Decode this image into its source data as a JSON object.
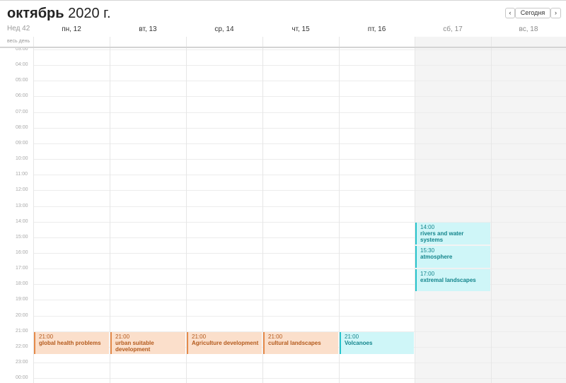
{
  "title": {
    "month": "октябрь",
    "year_suffix": "2020 г."
  },
  "nav": {
    "prev": "‹",
    "today": "Сегодня",
    "next": "›"
  },
  "week_label": "Нед 42",
  "all_day_label": "весь день",
  "days": [
    {
      "label": "пн, 12",
      "weekend": false
    },
    {
      "label": "вт, 13",
      "weekend": false
    },
    {
      "label": "ср, 14",
      "weekend": false
    },
    {
      "label": "чт, 15",
      "weekend": false
    },
    {
      "label": "пт, 16",
      "weekend": false
    },
    {
      "label": "сб, 17",
      "weekend": true
    },
    {
      "label": "вс, 18",
      "weekend": true
    }
  ],
  "hours": [
    "03:00",
    "04:00",
    "05:00",
    "06:00",
    "07:00",
    "08:00",
    "09:00",
    "10:00",
    "11:00",
    "12:00",
    "13:00",
    "14:00",
    "15:00",
    "16:00",
    "17:00",
    "18:00",
    "19:00",
    "20:00",
    "21:00",
    "22:00",
    "23:00",
    "00:00"
  ],
  "events": [
    {
      "day": 0,
      "start": 21,
      "end": 22.5,
      "time": "21:00",
      "title": "global health problems",
      "color": "orange"
    },
    {
      "day": 1,
      "start": 21,
      "end": 22.5,
      "time": "21:00",
      "title": "urban suitable development",
      "color": "orange"
    },
    {
      "day": 2,
      "start": 21,
      "end": 22.5,
      "time": "21:00",
      "title": "Agriculture development",
      "color": "orange"
    },
    {
      "day": 3,
      "start": 21,
      "end": 22.5,
      "time": "21:00",
      "title": "cultural landscapes",
      "color": "orange"
    },
    {
      "day": 4,
      "start": 21,
      "end": 22.5,
      "time": "21:00",
      "title": "Volcanoes",
      "color": "teal"
    },
    {
      "day": 5,
      "start": 14,
      "end": 15.5,
      "time": "14:00",
      "title": "rivers and water systems",
      "color": "teal"
    },
    {
      "day": 5,
      "start": 15.5,
      "end": 17,
      "time": "15:30",
      "title": "atmosphere",
      "color": "teal"
    },
    {
      "day": 5,
      "start": 17,
      "end": 18.5,
      "time": "17:00",
      "title": "extremal landscapes",
      "color": "teal"
    }
  ],
  "colors": {
    "orange_bg": "#fbdfcb",
    "orange_border": "#e58a4a",
    "teal_bg": "#cff6f8",
    "teal_border": "#27c4cc"
  }
}
